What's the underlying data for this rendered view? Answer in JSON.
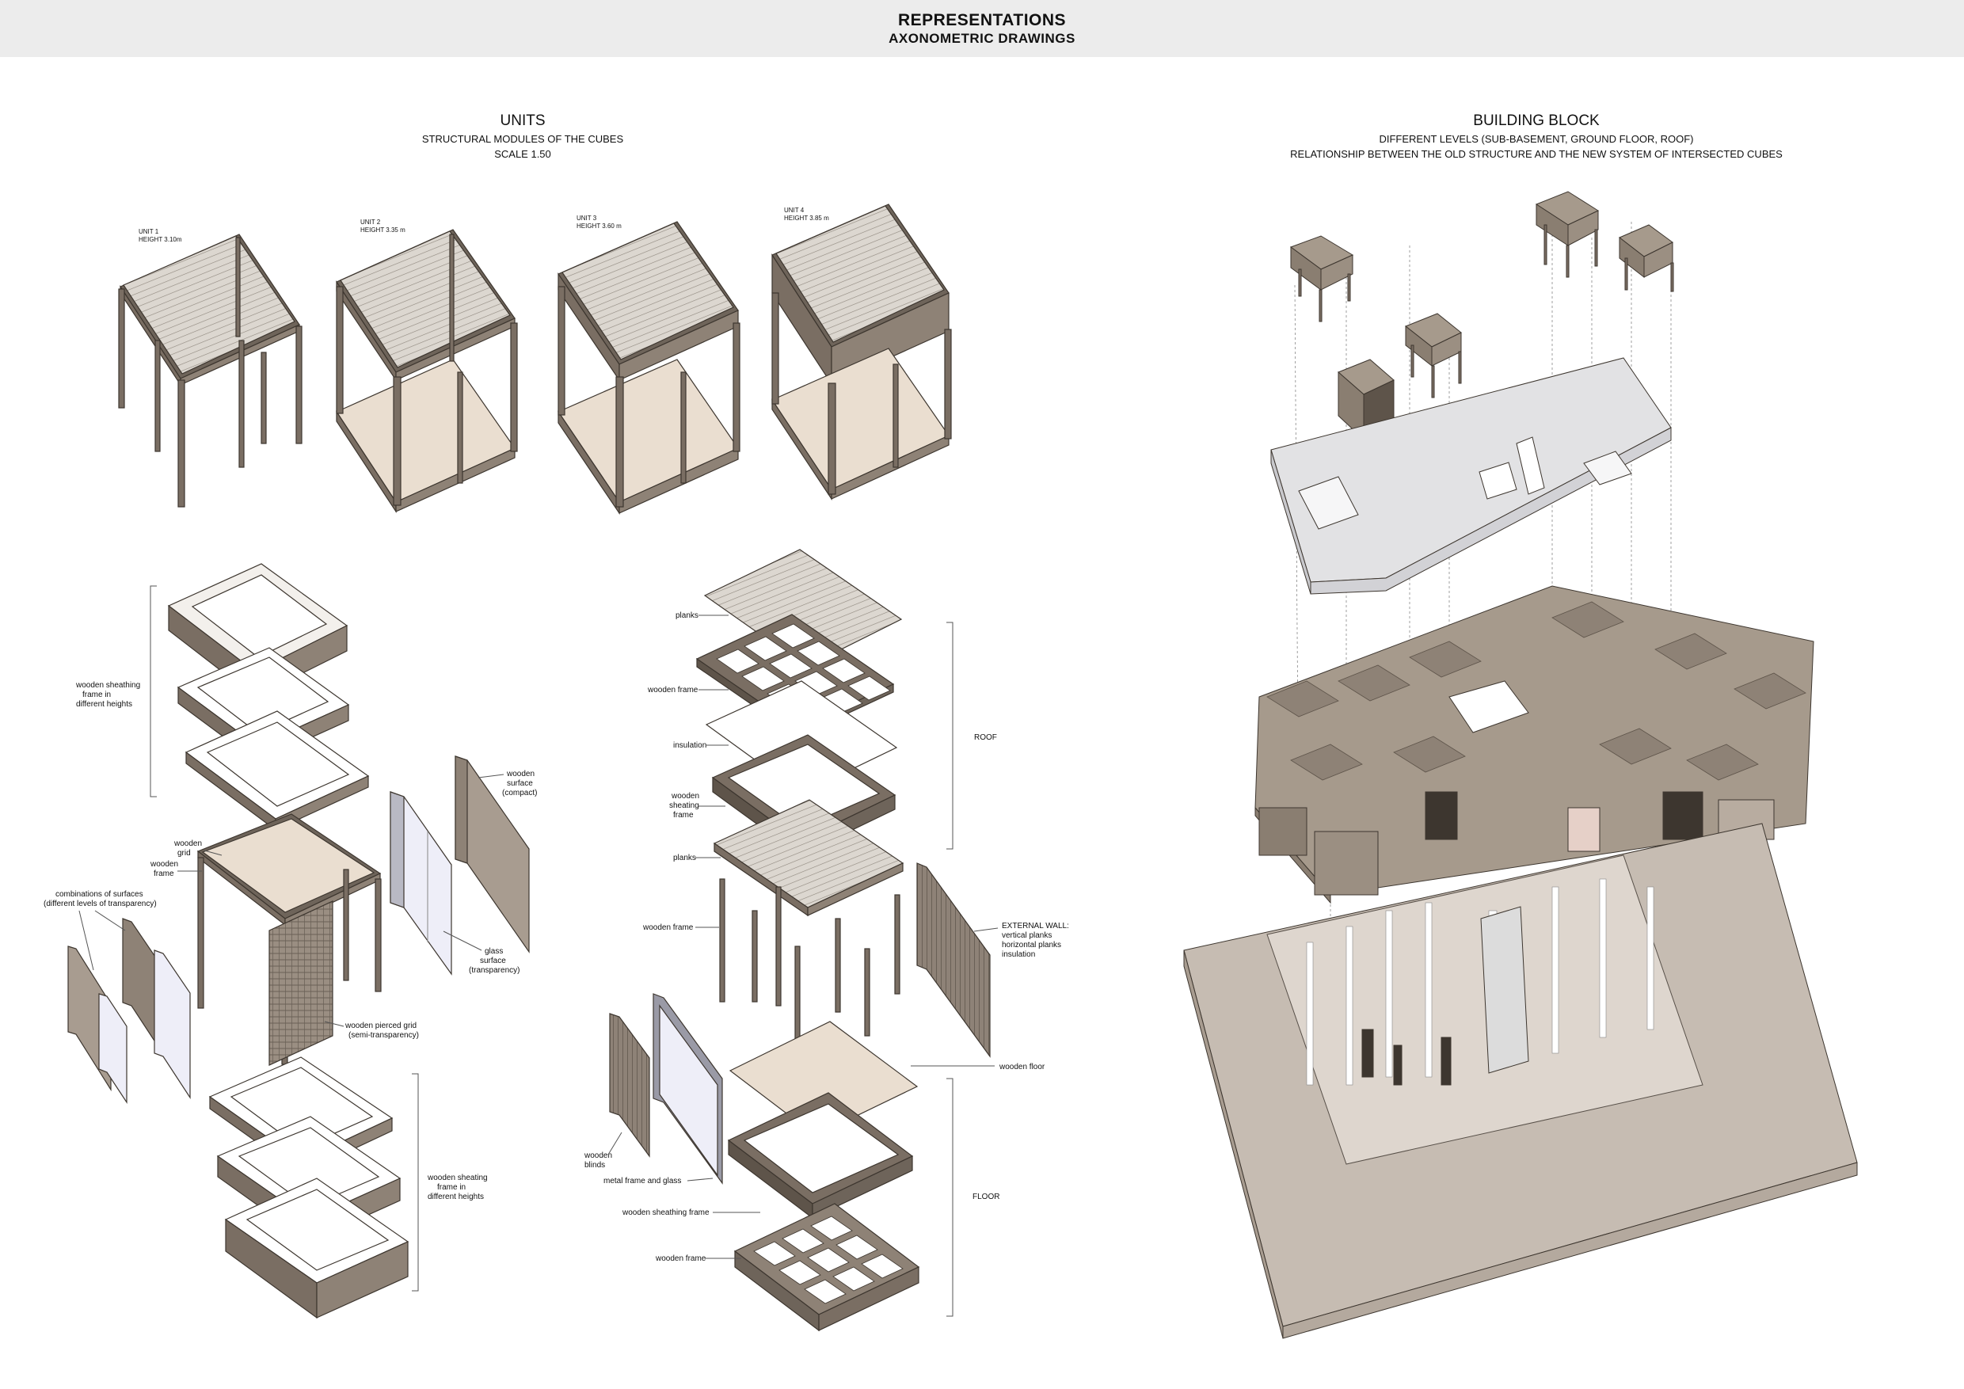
{
  "header": {
    "title": "REPRESENTATIONS",
    "subtitle": "AXONOMETRIC DRAWINGS"
  },
  "units_section": {
    "title": "UNITS",
    "line1": "STRUCTURAL MODULES OF THE CUBES",
    "line2": "SCALE 1.50"
  },
  "units": [
    {
      "name": "UNIT 1",
      "height": "HEIGHT 3.10m"
    },
    {
      "name": "UNIT 2",
      "height": "HEIGHT  3.35 m"
    },
    {
      "name": "UNIT 3",
      "height": "HEIGHT 3.60 m"
    },
    {
      "name": "UNIT 4",
      "height": "HEIGHT  3.85 m"
    }
  ],
  "block_section": {
    "title": "BUILDING BLOCK",
    "line1": "DIFFERENT LEVELS (SUB-BASEMENT, GROUND FLOOR, ROOF)",
    "line2": "RELATIONSHIP BETWEEN THE OLD STRUCTURE AND THE NEW SYSTEM OF INTERSECTED CUBES"
  },
  "left_labels": {
    "sheathing_top": [
      "wooden sheathing",
      "frame in",
      "different heights"
    ],
    "wooden_grid": [
      "wooden",
      "grid"
    ],
    "wooden_frame": [
      "wooden",
      "frame"
    ],
    "combinations": [
      "combinations of surfaces",
      "(different levels of transparency)"
    ],
    "wooden_surface": [
      "wooden",
      "surface",
      "(compact)"
    ],
    "glass_surface": [
      "glass",
      "surface",
      "(transparency)"
    ],
    "pierced_grid": [
      "wooden pierced grid",
      "(semi-transparency)"
    ],
    "sheathing_bottom": [
      "wooden sheating",
      "frame in",
      "different heights"
    ]
  },
  "middle_labels": {
    "planks_top": "planks",
    "wooden_frame_roof": "wooden frame",
    "insulation": "insulation",
    "sheating_frame": [
      "wooden",
      "sheating",
      "frame"
    ],
    "planks": "planks",
    "wooden_frame_columns": "wooden frame",
    "external_wall": [
      "EXTERNAL WALL:",
      "vertical planks",
      "horizontal planks",
      "insulation"
    ],
    "wooden_floor": "wooden floor",
    "wooden_blinds": [
      "wooden",
      "blinds"
    ],
    "metal_frame_glass": "metal frame and glass",
    "wooden_sheathing_frame": "wooden sheathing frame",
    "wooden_frame_floor": "wooden frame",
    "roof": "ROOF",
    "floor": "FLOOR"
  },
  "colors": {
    "header_bg": "#ececec",
    "frame": "#7a6e63",
    "frame_light": "#9b8f82",
    "planks": "#d8d3cc",
    "floor_wood": "#eaded0",
    "roof_cubes": "#a69a8c",
    "ground_slab": "#c6bcb2",
    "old_structure": "#e2e2e4",
    "glass": "#eeeef8"
  }
}
